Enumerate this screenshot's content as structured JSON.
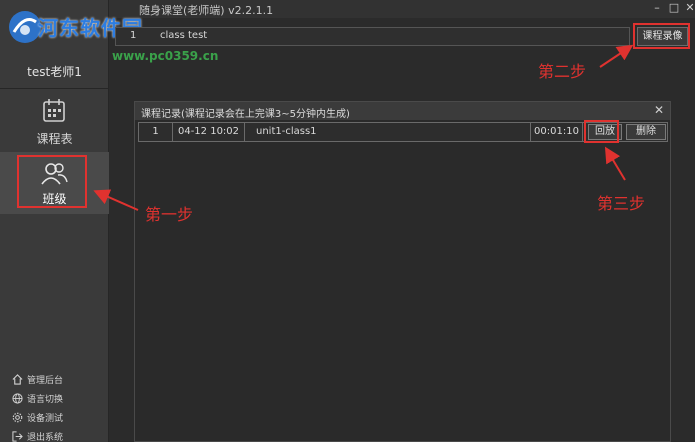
{
  "window": {
    "title": "随身课堂(老师端) v2.2.1.1",
    "minimize": "–",
    "maximize": "□",
    "close": "✕"
  },
  "watermark": {
    "text": "河东软件园",
    "url": "www.pc0359.cn"
  },
  "sidebar": {
    "user_name": "test老师1",
    "nav": [
      {
        "label": "课程表",
        "icon": "calendar-icon"
      },
      {
        "label": "班级",
        "icon": "users-icon"
      }
    ],
    "bottom_links": [
      {
        "label": "管理后台",
        "icon": "home-icon"
      },
      {
        "label": "语言切换",
        "icon": "globe-icon"
      },
      {
        "label": "设备测试",
        "icon": "gear-icon"
      },
      {
        "label": "退出系统",
        "icon": "logout-icon"
      }
    ]
  },
  "class_list": {
    "rows": [
      {
        "num": "1",
        "name": "class test"
      }
    ]
  },
  "record_button": "课程录像",
  "dialog": {
    "title": "课程记录(课程记录会在上完课3~5分钟内生成)",
    "close": "✕",
    "rows": [
      {
        "num": "1",
        "time": "04-12 10:02",
        "name": "unit1-class1",
        "duration": "00:01:10",
        "play": "回放",
        "delete": "删除"
      }
    ]
  },
  "annotations": {
    "step1": "第一步",
    "step2": "第二步",
    "step3": "第三步",
    "color": "#e0322f"
  },
  "colors": {
    "background": "#2b2b2b",
    "sidebar": "#3a3a3a",
    "selected_nav": "#4a4a4a"
  }
}
